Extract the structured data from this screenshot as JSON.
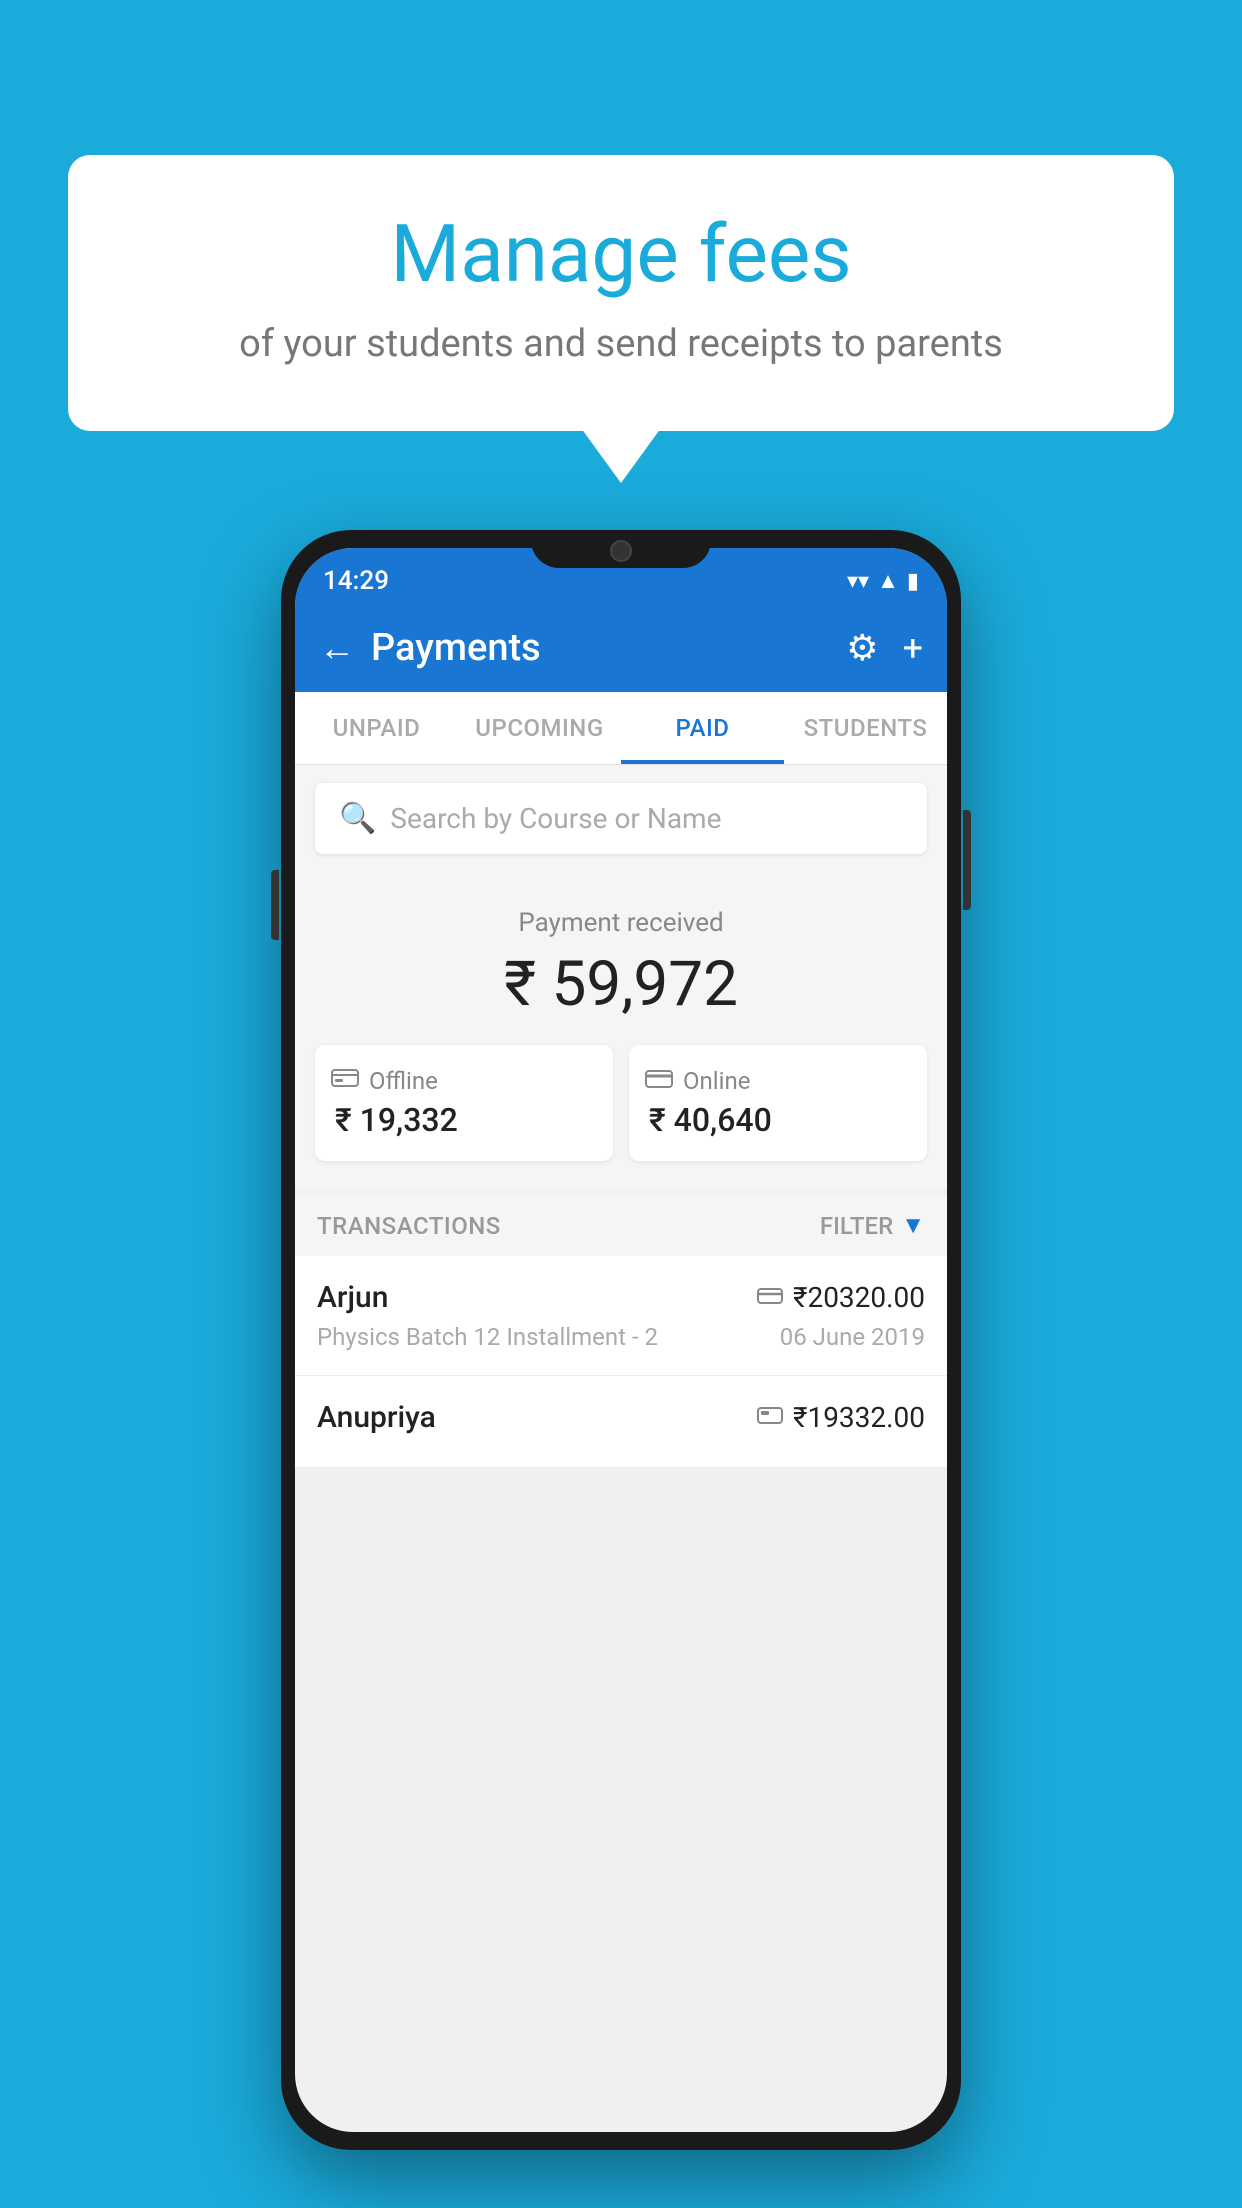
{
  "background_color": "#1AABDB",
  "speech_bubble": {
    "title": "Manage fees",
    "subtitle": "of your students and send receipts to parents"
  },
  "status_bar": {
    "time": "14:29",
    "wifi": "▼",
    "signal": "▲",
    "battery": "▮"
  },
  "header": {
    "title": "Payments",
    "back_label": "←",
    "settings_label": "⚙",
    "add_label": "+"
  },
  "tabs": [
    {
      "label": "UNPAID",
      "active": false
    },
    {
      "label": "UPCOMING",
      "active": false
    },
    {
      "label": "PAID",
      "active": true
    },
    {
      "label": "STUDENTS",
      "active": false
    }
  ],
  "search": {
    "placeholder": "Search by Course or Name"
  },
  "payment_summary": {
    "label": "Payment received",
    "amount": "₹ 59,972",
    "offline": {
      "icon": "💳",
      "label": "Offline",
      "amount": "₹ 19,332"
    },
    "online": {
      "icon": "💳",
      "label": "Online",
      "amount": "₹ 40,640"
    }
  },
  "transactions": {
    "label": "TRANSACTIONS",
    "filter_label": "FILTER",
    "items": [
      {
        "name": "Arjun",
        "detail": "Physics Batch 12 Installment - 2",
        "amount": "₹20320.00",
        "date": "06 June 2019",
        "type": "online"
      },
      {
        "name": "Anupriya",
        "detail": "",
        "amount": "₹19332.00",
        "date": "",
        "type": "offline"
      }
    ]
  }
}
